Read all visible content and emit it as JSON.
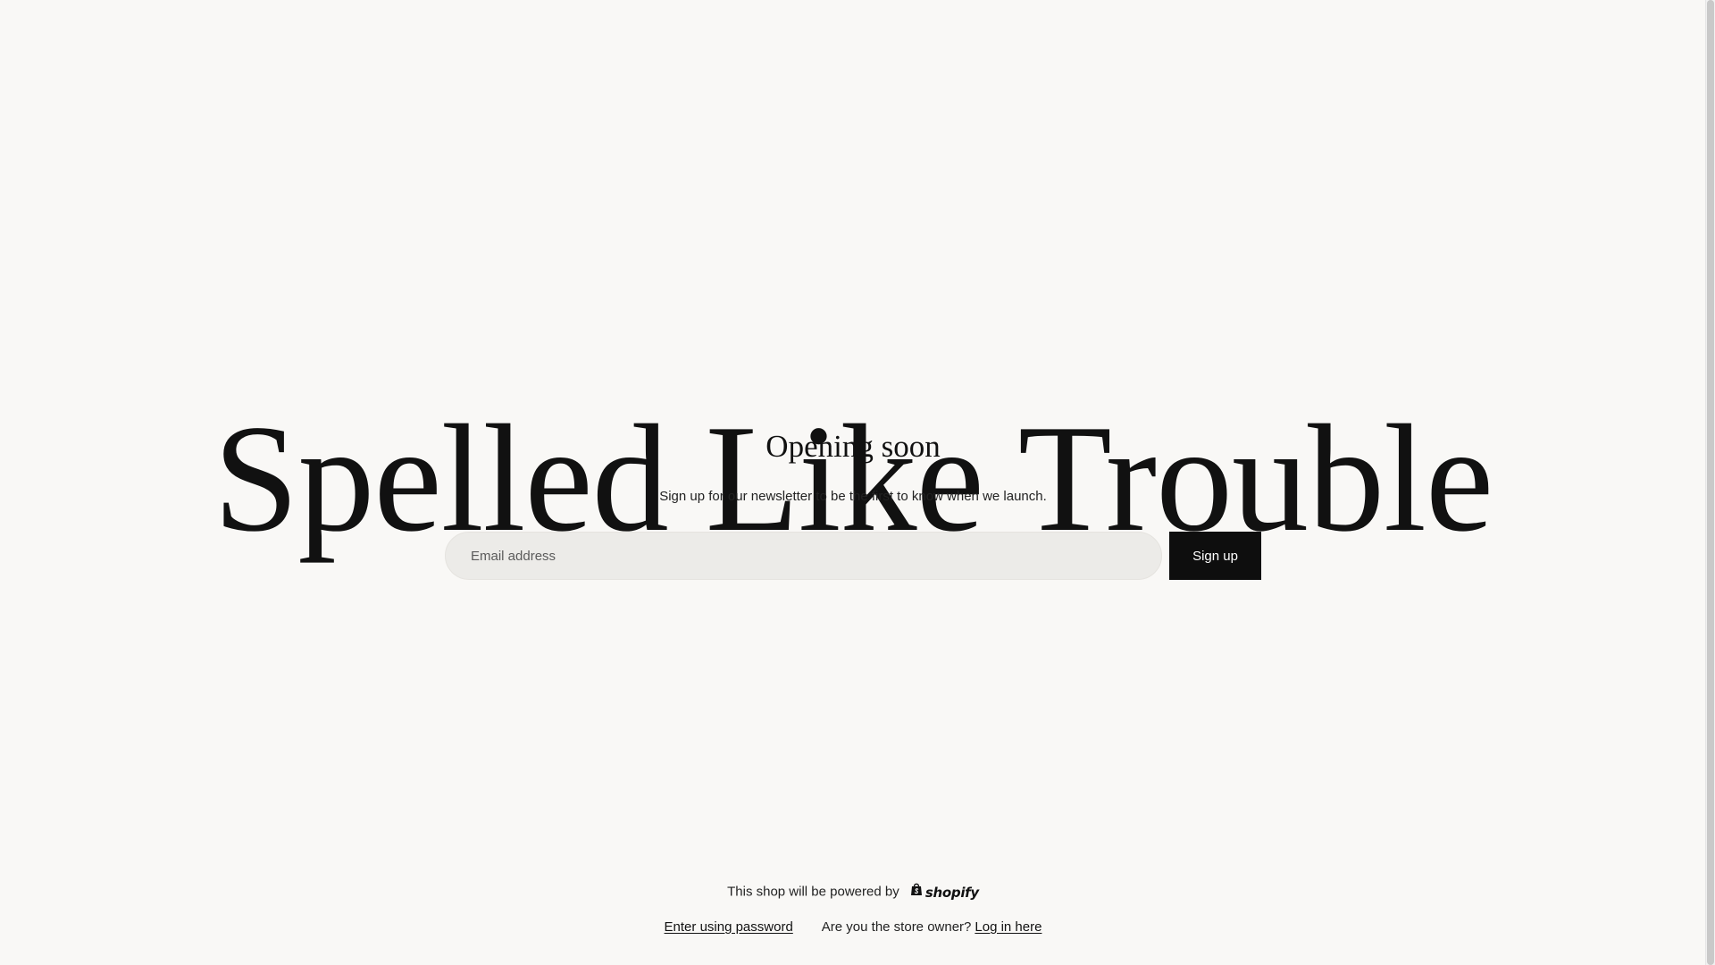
{
  "store": {
    "title": "Spelled Like Trouble",
    "subtitle": "Opening soon",
    "newsletter_text": "Sign up for our newsletter to be the first to know when we launch."
  },
  "signup": {
    "email_placeholder": "Email address",
    "button_label": "Sign up"
  },
  "footer": {
    "powered_by_text": "This shop will be powered by",
    "powered_by_brand": "shopify",
    "enter_password_label": "Enter using password",
    "owner_question": "Are you the store owner?",
    "login_label": "Log in here"
  },
  "icons": {
    "shopify_bag": "shopify-bag-icon"
  },
  "colors": {
    "background": "#f9f8f6",
    "button": "#0e0e0e",
    "input_background": "#ecebe8"
  }
}
